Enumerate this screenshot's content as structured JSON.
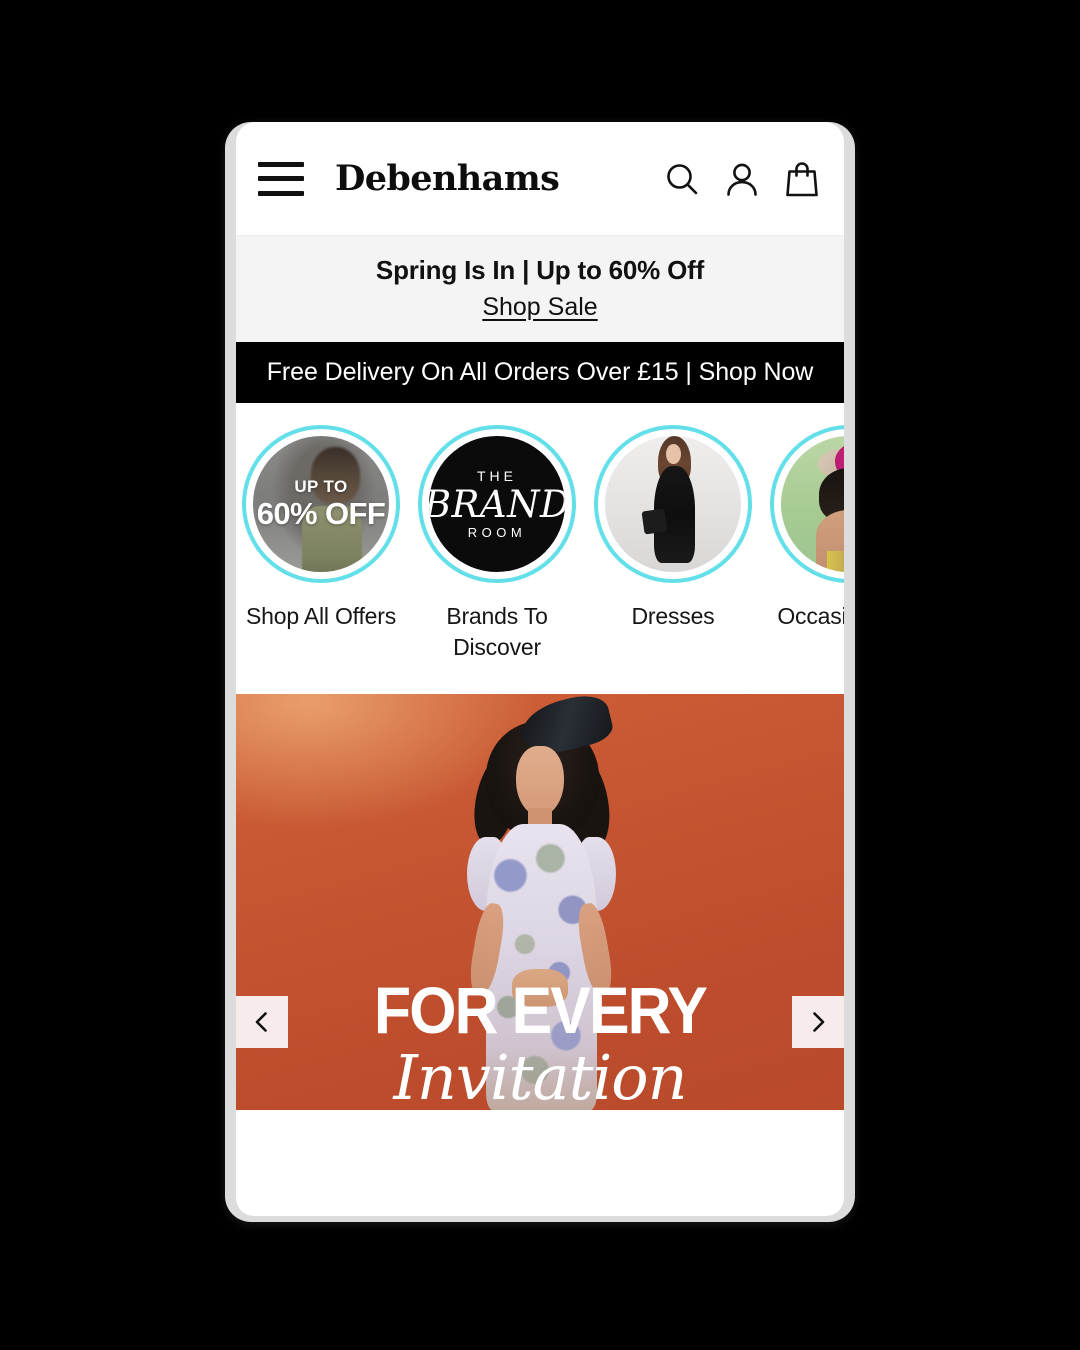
{
  "header": {
    "menu_icon": "hamburger-menu-icon",
    "brand": "Debenhams",
    "icons": [
      {
        "name": "search-icon",
        "label": "Search"
      },
      {
        "name": "account-icon",
        "label": "Account"
      },
      {
        "name": "bag-icon",
        "label": "Bag"
      }
    ]
  },
  "promos": {
    "light": {
      "title": "Spring Is In | Up to 60% Off",
      "link": "Shop Sale",
      "background": "#f4f4f4"
    },
    "dark": {
      "text": "Free Delivery On All Orders Over £15 | Shop Now",
      "background": "#000000"
    }
  },
  "categories": {
    "ring_color": "#62dfe8",
    "items": [
      {
        "label": "Shop All Offers",
        "bubble": "offers",
        "overlay_small": "UP TO",
        "overlay_big": "60% OFF"
      },
      {
        "label": "Brands To Discover",
        "bubble": "brand-room",
        "logo_line1": "THE",
        "logo_line2": "BRAND",
        "logo_line3": "ROOM"
      },
      {
        "label": "Dresses",
        "bubble": "dresses"
      },
      {
        "label": "Occasionwear",
        "bubble": "occasion"
      }
    ]
  },
  "hero": {
    "line1": "FOR EVERY",
    "line2": "Invitation",
    "background_color": "#c1512d",
    "prev_label": "Previous slide",
    "next_label": "Next slide"
  }
}
